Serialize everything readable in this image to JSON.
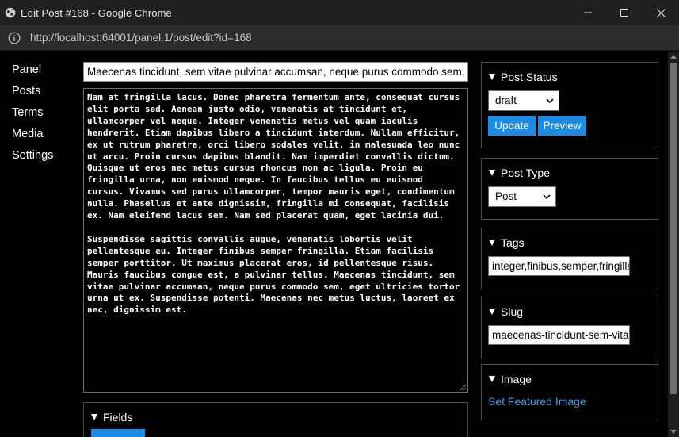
{
  "window": {
    "title": "Edit Post #168 - Google Chrome",
    "url": "http://localhost:64001/panel.1/post/edit?id=168"
  },
  "sidebar": {
    "items": [
      {
        "label": "Panel"
      },
      {
        "label": "Posts"
      },
      {
        "label": "Terms"
      },
      {
        "label": "Media"
      },
      {
        "label": "Settings"
      }
    ]
  },
  "editor": {
    "title_value": "Maecenas tincidunt, sem vitae pulvinar accumsan, neque purus commodo sem, eget ultricies tortor urna ut ex.",
    "content_value": "Nam at fringilla lacus. Donec pharetra fermentum ante, consequat cursus elit porta sed. Aenean justo odio, venenatis at tincidunt et, ullamcorper vel neque. Integer venenatis metus vel quam iaculis hendrerit. Etiam dapibus libero a tincidunt interdum. Nullam efficitur, ex ut rutrum pharetra, orci libero sodales velit, in malesuada leo nunc ut arcu. Proin cursus dapibus blandit. Nam imperdiet convallis dictum. Quisque ut eros nec metus cursus rhoncus non ac ligula. Proin eu fringilla urna, non euismod neque. In faucibus tellus eu euismod cursus. Vivamus sed purus ullamcorper, tempor mauris eget, condimentum nulla. Phasellus et ante dignissim, fringilla mi consequat, facilisis ex. Nam eleifend lacus sem. Nam sed placerat quam, eget lacinia dui.\n\nSuspendisse sagittis convallis augue, venenatis lobortis velit pellentesque eu. Integer finibus semper fringilla. Etiam facilisis semper porttitor. Ut maximus placerat eros, id pellentesque risus. Mauris faucibus congue est, a pulvinar tellus. Maecenas tincidunt, sem vitae pulvinar accumsan, neque purus commodo sem, eget ultricies tortor urna ut ex. Suspendisse potenti. Maecenas nec metus luctus, laoreet ex nec, dignissim est."
  },
  "fields": {
    "title": "Fields"
  },
  "post_status": {
    "title": "Post Status",
    "selected": "draft",
    "update_label": "Update",
    "preview_label": "Preview"
  },
  "post_type": {
    "title": "Post Type",
    "selected": "Post"
  },
  "tags": {
    "title": "Tags",
    "value": "integer,finibus,semper,fringilla"
  },
  "slug": {
    "title": "Slug",
    "value": "maecenas-tincidunt-sem-vitae"
  },
  "image": {
    "title": "Image",
    "link_label": "Set Featured Image"
  },
  "colors": {
    "accent": "#1a8ce6",
    "link": "#3d9ee8",
    "background": "#000000"
  }
}
